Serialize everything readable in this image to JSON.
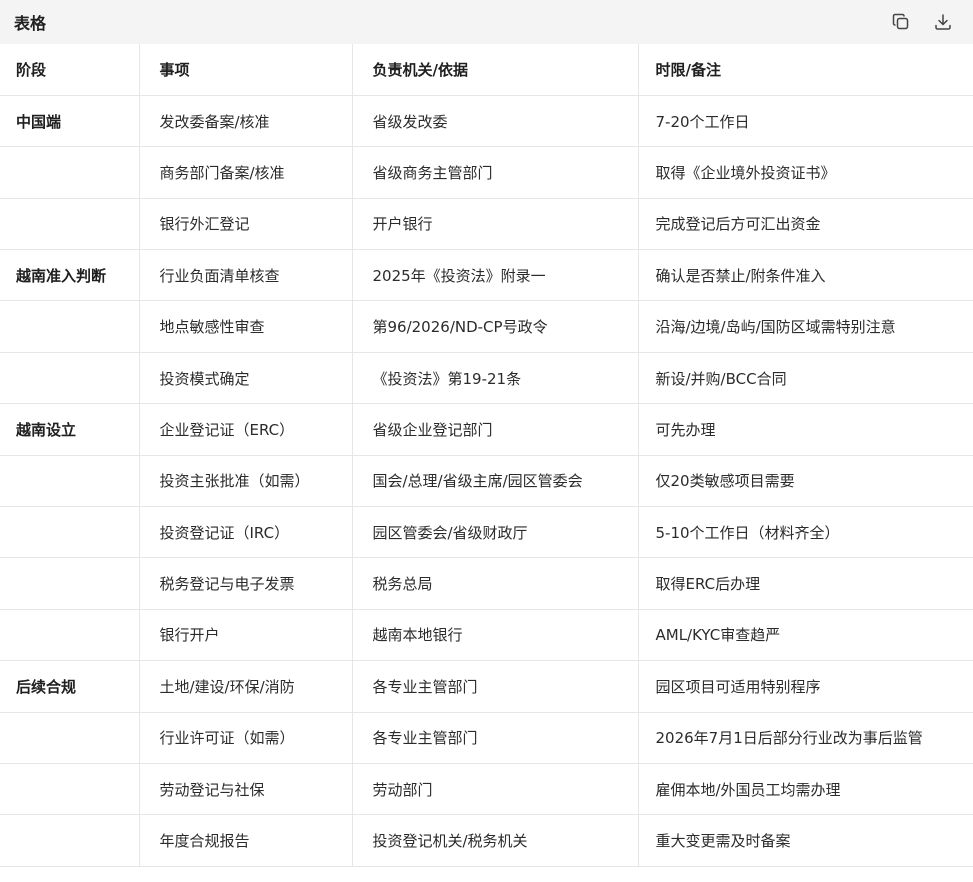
{
  "toolbar": {
    "title": "表格",
    "copy_icon": "copy-icon",
    "download_icon": "download-icon"
  },
  "table": {
    "headers": [
      "阶段",
      "事项",
      "负责机关/依据",
      "时限/备注"
    ],
    "rows": [
      {
        "stage": "中国端",
        "item": "发改委备案/核准",
        "authority": "省级发改委",
        "note": "7-20个工作日"
      },
      {
        "stage": "",
        "item": "商务部门备案/核准",
        "authority": "省级商务主管部门",
        "note": "取得《企业境外投资证书》"
      },
      {
        "stage": "",
        "item": "银行外汇登记",
        "authority": "开户银行",
        "note": "完成登记后方可汇出资金"
      },
      {
        "stage": "越南准入判断",
        "item": "行业负面清单核查",
        "authority": "2025年《投资法》附录一",
        "note": "确认是否禁止/附条件准入"
      },
      {
        "stage": "",
        "item": "地点敏感性审查",
        "authority": "第96/2026/ND-CP号政令",
        "note": "沿海/边境/岛屿/国防区域需特别注意"
      },
      {
        "stage": "",
        "item": "投资模式确定",
        "authority": "《投资法》第19-21条",
        "note": "新设/并购/BCC合同"
      },
      {
        "stage": "越南设立",
        "item": "企业登记证（ERC）",
        "authority": "省级企业登记部门",
        "note": "可先办理"
      },
      {
        "stage": "",
        "item": "投资主张批准（如需）",
        "authority": "国会/总理/省级主席/园区管委会",
        "note": "仅20类敏感项目需要"
      },
      {
        "stage": "",
        "item": "投资登记证（IRC）",
        "authority": "园区管委会/省级财政厅",
        "note": "5-10个工作日（材料齐全）"
      },
      {
        "stage": "",
        "item": "税务登记与电子发票",
        "authority": "税务总局",
        "note": "取得ERC后办理"
      },
      {
        "stage": "",
        "item": "银行开户",
        "authority": "越南本地银行",
        "note": "AML/KYC审查趋严"
      },
      {
        "stage": "后续合规",
        "item": "土地/建设/环保/消防",
        "authority": "各专业主管部门",
        "note": "园区项目可适用特别程序"
      },
      {
        "stage": "",
        "item": "行业许可证（如需）",
        "authority": "各专业主管部门",
        "note": "2026年7月1日后部分行业改为事后监管"
      },
      {
        "stage": "",
        "item": "劳动登记与社保",
        "authority": "劳动部门",
        "note": "雇佣本地/外国员工均需办理"
      },
      {
        "stage": "",
        "item": "年度合规报告",
        "authority": "投资登记机关/税务机关",
        "note": "重大变更需及时备案"
      }
    ]
  }
}
